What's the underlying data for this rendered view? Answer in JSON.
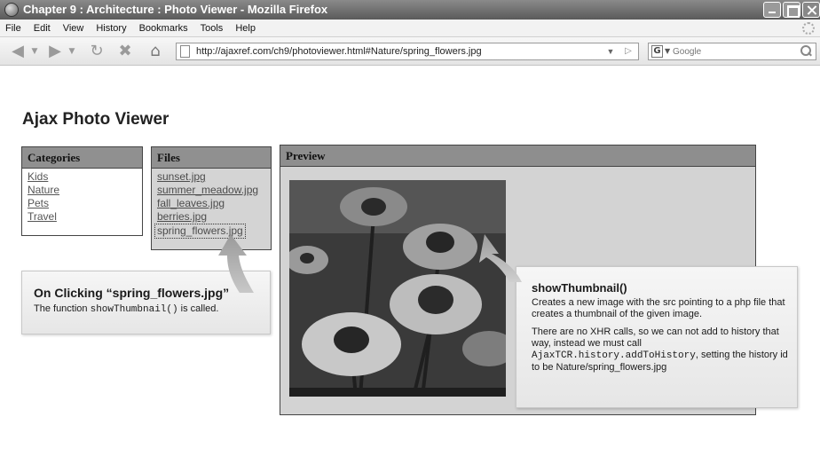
{
  "window": {
    "title": "Chapter 9 : Architecture : Photo Viewer - Mozilla Firefox"
  },
  "menu": [
    "File",
    "Edit",
    "View",
    "History",
    "Bookmarks",
    "Tools",
    "Help"
  ],
  "nav": {
    "url": "http://ajaxref.com/ch9/photoviewer.html#Nature/spring_flowers.jpg",
    "search_engine": "G",
    "search_placeholder": "Google"
  },
  "page": {
    "title": "Ajax Photo Viewer",
    "categories": {
      "header": "Categories",
      "items": [
        "Kids",
        "Nature",
        "Pets",
        "Travel"
      ]
    },
    "files": {
      "header": "Files",
      "items": [
        "sunset.jpg",
        "summer_meadow.jpg",
        "fall_leaves.jpg",
        "berries.jpg",
        "spring_flowers.jpg"
      ],
      "selected_index": 4
    },
    "preview": {
      "header": "Preview"
    }
  },
  "callouts": {
    "left": {
      "title": "On Clicking “spring_flowers.jpg”",
      "body_prefix": "The function ",
      "body_code": "showThumbnail()",
      "body_suffix": " is called."
    },
    "right": {
      "title": "showThumbnail()",
      "p1": "Creates a new image with the src pointing to a php file that creates a thumbnail of the given image.",
      "p2_prefix": "There are no XHR calls, so we can not add to history that way, instead we must call ",
      "p2_code": "AjaxTCR.history.addToHistory",
      "p2_suffix": ", setting the history id to be Nature/spring_flowers.jpg"
    }
  },
  "colors": {
    "panel_header": "#909090",
    "files_bg": "#d4d4d4",
    "preview_bg": "#d3d3d3",
    "callout_bg": "#eeeeee"
  },
  "icons": [
    "firefox-icon",
    "back-icon",
    "forward-icon",
    "reload-icon",
    "stop-icon",
    "home-icon",
    "page-icon",
    "go-icon",
    "search-icon"
  ]
}
